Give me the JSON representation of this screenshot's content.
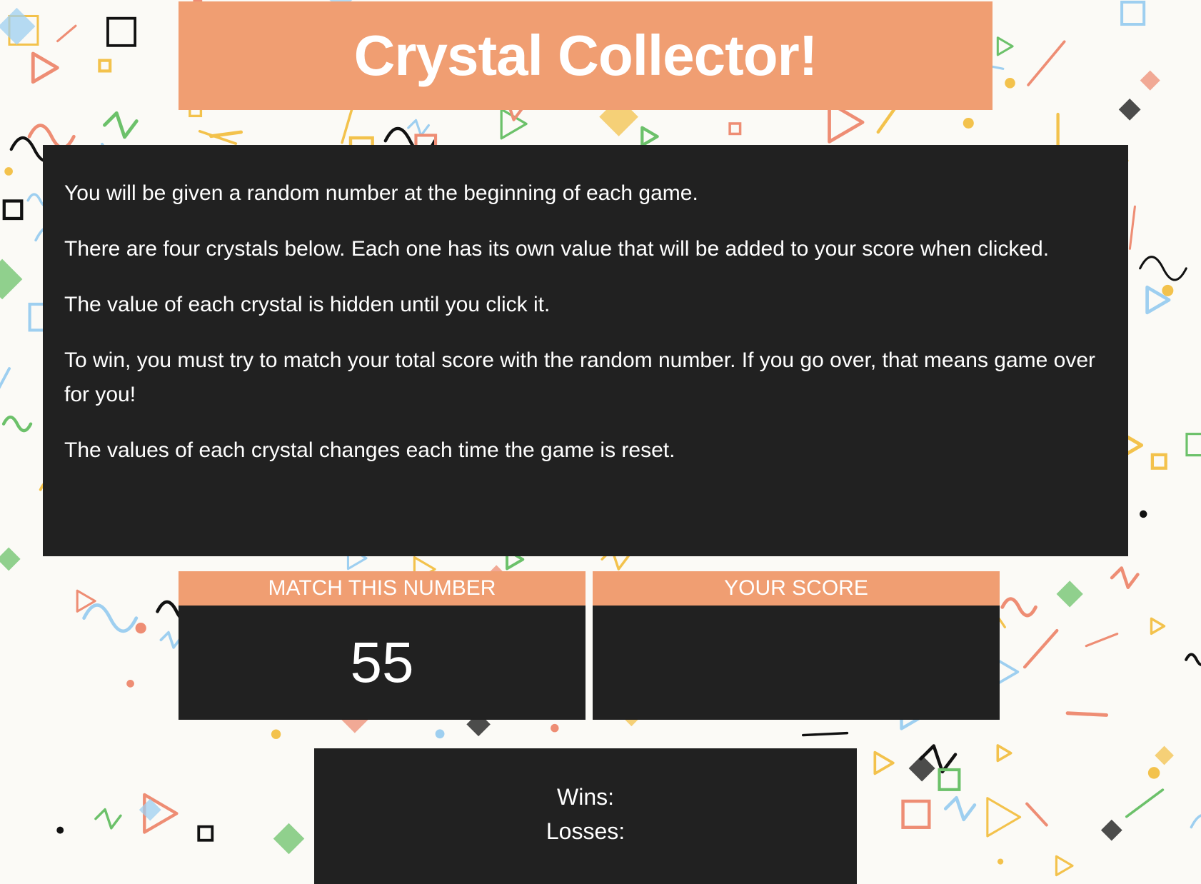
{
  "header": {
    "title": "Crystal Collector!"
  },
  "instructions": {
    "paragraphs": [
      "You will be given a random number at the beginning of each game.",
      "There are four crystals below. Each one has its own value that will be added to your score when clicked.",
      "The value of each crystal is hidden until you click it.",
      "To win, you must try to match your total score with the random number. If you go over, that means game over for you!",
      "The values of each crystal changes each time the game is reset."
    ]
  },
  "target": {
    "label": "MATCH THIS NUMBER",
    "value": "55"
  },
  "score": {
    "label": "YOUR SCORE",
    "value": ""
  },
  "stats": {
    "wins_label": "Wins:",
    "wins_value": "",
    "losses_label": "Losses:",
    "losses_value": ""
  },
  "colors": {
    "accent": "#f09e72",
    "panel": "#212121",
    "text": "#ffffff",
    "background": "#fbfaf6"
  },
  "background_pattern": {
    "shape_colors": [
      "#f3c24c",
      "#6cc16a",
      "#9ecff0",
      "#ee8d74",
      "#111111"
    ]
  }
}
